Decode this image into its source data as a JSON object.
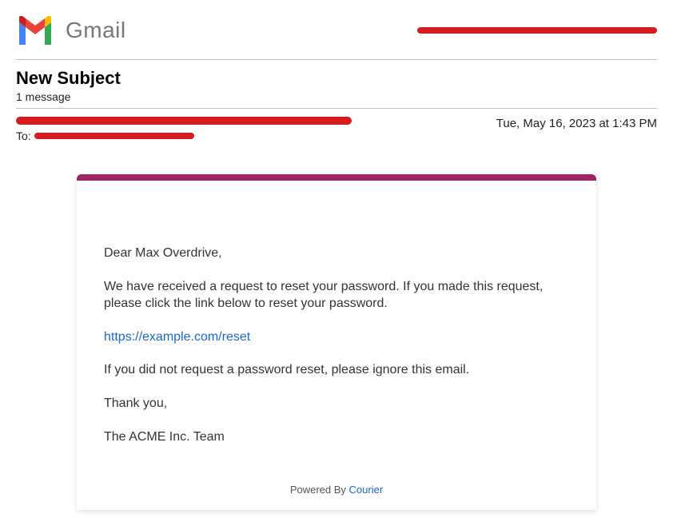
{
  "header": {
    "product_name": "Gmail"
  },
  "thread": {
    "subject": "New Subject",
    "message_count": "1 message",
    "to_label": "To:",
    "timestamp": "Tue, May 16, 2023 at 1:43 PM"
  },
  "body": {
    "greeting": "Dear Max Overdrive,",
    "paragraph1": "We have received a request to reset your password. If you made this request, please click the link below to reset your password.",
    "reset_link_text": "https://example.com/reset",
    "reset_link_href": "https://example.com/reset",
    "paragraph2": "If you did not request a password reset, please ignore this email.",
    "closing": "Thank you,",
    "signoff": "The ACME Inc. Team"
  },
  "footer": {
    "powered_prefix": "Powered By ",
    "courier_text": "Courier"
  }
}
